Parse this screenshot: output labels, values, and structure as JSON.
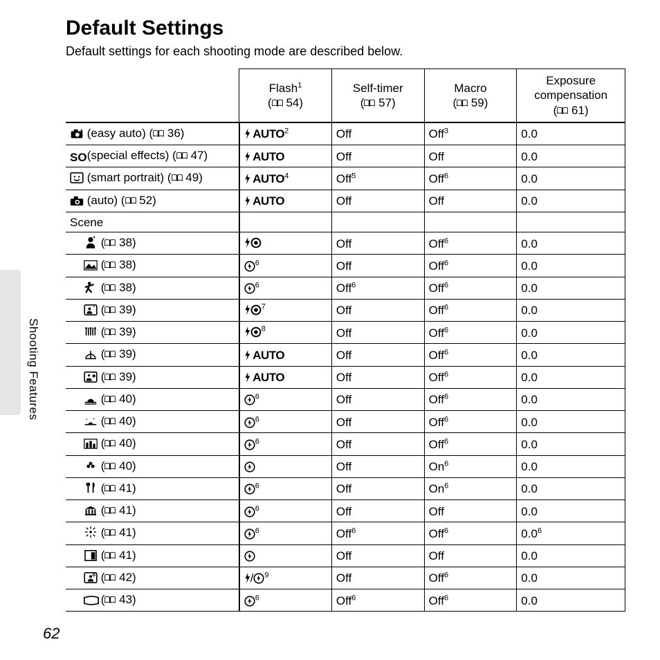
{
  "page": {
    "title": "Default Settings",
    "intro": "Default settings for each shooting mode are described below.",
    "sidebar_label": "Shooting Features",
    "page_number": "62"
  },
  "columns": {
    "flash": {
      "label": "Flash",
      "sup": "1",
      "page": "54"
    },
    "self_timer": {
      "label": "Self-timer",
      "page": "57"
    },
    "macro": {
      "label": "Macro",
      "page": "59"
    },
    "exp": {
      "label_l1": "Exposure",
      "label_l2": "compensation",
      "page": "61"
    }
  },
  "rows": [
    {
      "icon": "easy-auto",
      "label": "(easy auto)",
      "page": "36",
      "scene": false,
      "flash": {
        "type": "auto",
        "sup": "2"
      },
      "self": {
        "text": "Off"
      },
      "macro": {
        "text": "Off",
        "sup": "3"
      },
      "exp": {
        "text": "0.0"
      }
    },
    {
      "icon": "so",
      "label": "(special effects)",
      "page": "47",
      "scene": false,
      "flash": {
        "type": "auto"
      },
      "self": {
        "text": "Off"
      },
      "macro": {
        "text": "Off"
      },
      "exp": {
        "text": "0.0"
      }
    },
    {
      "icon": "smart-portrait",
      "label": "(smart portrait)",
      "page": "49",
      "scene": false,
      "flash": {
        "type": "auto",
        "sup": "4"
      },
      "self": {
        "text": "Off",
        "sup": "5"
      },
      "macro": {
        "text": "Off",
        "sup": "6"
      },
      "exp": {
        "text": "0.0"
      }
    },
    {
      "icon": "auto-camera",
      "label": "(auto)",
      "page": "52",
      "scene": false,
      "flash": {
        "type": "auto"
      },
      "self": {
        "text": "Off"
      },
      "macro": {
        "text": "Off"
      },
      "exp": {
        "text": "0.0"
      }
    },
    {
      "scene_header": true,
      "label": "Scene"
    },
    {
      "icon": "portrait",
      "page": "38",
      "scene": true,
      "flash": {
        "type": "redeye"
      },
      "self": {
        "text": "Off"
      },
      "macro": {
        "text": "Off",
        "sup": "6"
      },
      "exp": {
        "text": "0.0"
      }
    },
    {
      "icon": "landscape",
      "page": "38",
      "scene": true,
      "flash": {
        "type": "noflash",
        "sup": "6"
      },
      "self": {
        "text": "Off"
      },
      "macro": {
        "text": "Off",
        "sup": "6"
      },
      "exp": {
        "text": "0.0"
      }
    },
    {
      "icon": "sports",
      "page": "38",
      "scene": true,
      "flash": {
        "type": "noflash",
        "sup": "6"
      },
      "self": {
        "text": "Off",
        "sup": "6"
      },
      "macro": {
        "text": "Off",
        "sup": "6"
      },
      "exp": {
        "text": "0.0"
      }
    },
    {
      "icon": "night-portrait",
      "page": "39",
      "scene": true,
      "flash": {
        "type": "redeye",
        "sup": "7"
      },
      "self": {
        "text": "Off"
      },
      "macro": {
        "text": "Off",
        "sup": "6"
      },
      "exp": {
        "text": "0.0"
      }
    },
    {
      "icon": "party",
      "page": "39",
      "scene": true,
      "flash": {
        "type": "redeye",
        "sup": "8"
      },
      "self": {
        "text": "Off"
      },
      "macro": {
        "text": "Off",
        "sup": "6"
      },
      "exp": {
        "text": "0.0"
      }
    },
    {
      "icon": "beach",
      "page": "39",
      "scene": true,
      "flash": {
        "type": "auto"
      },
      "self": {
        "text": "Off"
      },
      "macro": {
        "text": "Off",
        "sup": "6"
      },
      "exp": {
        "text": "0.0"
      }
    },
    {
      "icon": "snow",
      "page": "39",
      "scene": true,
      "flash": {
        "type": "auto"
      },
      "self": {
        "text": "Off"
      },
      "macro": {
        "text": "Off",
        "sup": "6"
      },
      "exp": {
        "text": "0.0"
      }
    },
    {
      "icon": "sunset",
      "page": "40",
      "scene": true,
      "flash": {
        "type": "noflash",
        "sup": "6"
      },
      "self": {
        "text": "Off"
      },
      "macro": {
        "text": "Off",
        "sup": "6"
      },
      "exp": {
        "text": "0.0"
      }
    },
    {
      "icon": "dusk",
      "page": "40",
      "scene": true,
      "flash": {
        "type": "noflash",
        "sup": "6"
      },
      "self": {
        "text": "Off"
      },
      "macro": {
        "text": "Off",
        "sup": "6"
      },
      "exp": {
        "text": "0.0"
      }
    },
    {
      "icon": "night-landscape",
      "page": "40",
      "scene": true,
      "flash": {
        "type": "noflash",
        "sup": "6"
      },
      "self": {
        "text": "Off"
      },
      "macro": {
        "text": "Off",
        "sup": "6"
      },
      "exp": {
        "text": "0.0"
      }
    },
    {
      "icon": "closeup",
      "page": "40",
      "scene": true,
      "flash": {
        "type": "noflash"
      },
      "self": {
        "text": "Off"
      },
      "macro": {
        "text": "On",
        "sup": "6"
      },
      "exp": {
        "text": "0.0"
      }
    },
    {
      "icon": "food",
      "page": "41",
      "scene": true,
      "flash": {
        "type": "noflash",
        "sup": "6"
      },
      "self": {
        "text": "Off"
      },
      "macro": {
        "text": "On",
        "sup": "6"
      },
      "exp": {
        "text": "0.0"
      }
    },
    {
      "icon": "museum",
      "page": "41",
      "scene": true,
      "flash": {
        "type": "noflash",
        "sup": "6"
      },
      "self": {
        "text": "Off"
      },
      "macro": {
        "text": "Off"
      },
      "exp": {
        "text": "0.0"
      }
    },
    {
      "icon": "fireworks",
      "page": "41",
      "scene": true,
      "flash": {
        "type": "noflash",
        "sup": "6"
      },
      "self": {
        "text": "Off",
        "sup": "6"
      },
      "macro": {
        "text": "Off",
        "sup": "6"
      },
      "exp": {
        "text": "0.0",
        "sup": "6"
      }
    },
    {
      "icon": "copy",
      "page": "41",
      "scene": true,
      "flash": {
        "type": "noflash"
      },
      "self": {
        "text": "Off"
      },
      "macro": {
        "text": "Off"
      },
      "exp": {
        "text": "0.0"
      }
    },
    {
      "icon": "backlight",
      "page": "42",
      "scene": true,
      "flash": {
        "type": "fill-noflash",
        "sup": "9"
      },
      "self": {
        "text": "Off"
      },
      "macro": {
        "text": "Off",
        "sup": "6"
      },
      "exp": {
        "text": "0.0"
      }
    },
    {
      "icon": "panorama",
      "page": "43",
      "scene": true,
      "flash": {
        "type": "noflash",
        "sup": "6"
      },
      "self": {
        "text": "Off",
        "sup": "6"
      },
      "macro": {
        "text": "Off",
        "sup": "6"
      },
      "exp": {
        "text": "0.0"
      }
    }
  ]
}
